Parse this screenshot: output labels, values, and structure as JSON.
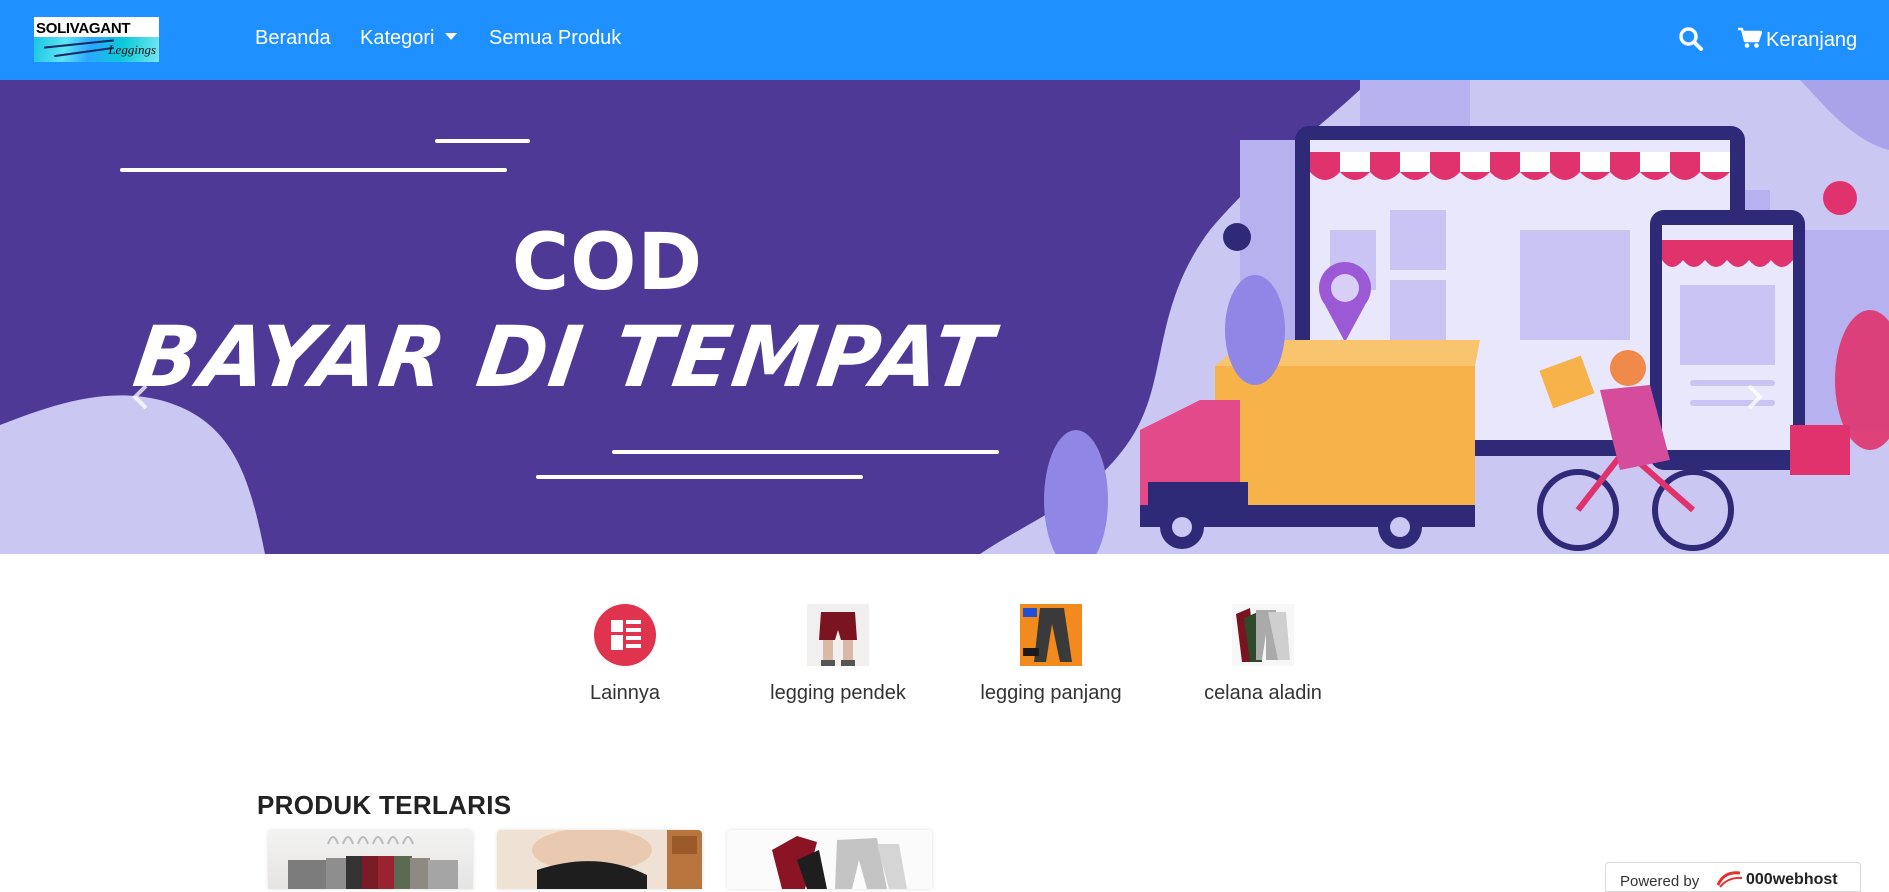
{
  "header": {
    "logo_text_top": "SOLIVAGANT",
    "logo_text_bottom": "Leggings",
    "nav": {
      "home": "Beranda",
      "category": "Kategori",
      "all_products": "Semua Produk"
    },
    "cart_label": "Keranjang",
    "icons": [
      "search-icon",
      "cart-icon",
      "chevron-down-icon"
    ],
    "bar_color": "#1e90ff"
  },
  "carousel": {
    "title": "COD",
    "subtitle": "BAYAR DI TEMPAT",
    "slide_count": 3,
    "active_index": 1,
    "colors": {
      "purple": "#4d3795",
      "lavender": "#c9c5f2",
      "pink": "#e0336e"
    }
  },
  "categories": [
    {
      "label": "Lainnya",
      "icon": "list-icon"
    },
    {
      "label": "legging pendek"
    },
    {
      "label": "legging panjang"
    },
    {
      "label": "celana aladin"
    }
  ],
  "bestsellers": {
    "title": "PRODUK TERLARIS"
  },
  "footer_badge": {
    "prefix": "Powered by",
    "brand": "000webhost"
  }
}
